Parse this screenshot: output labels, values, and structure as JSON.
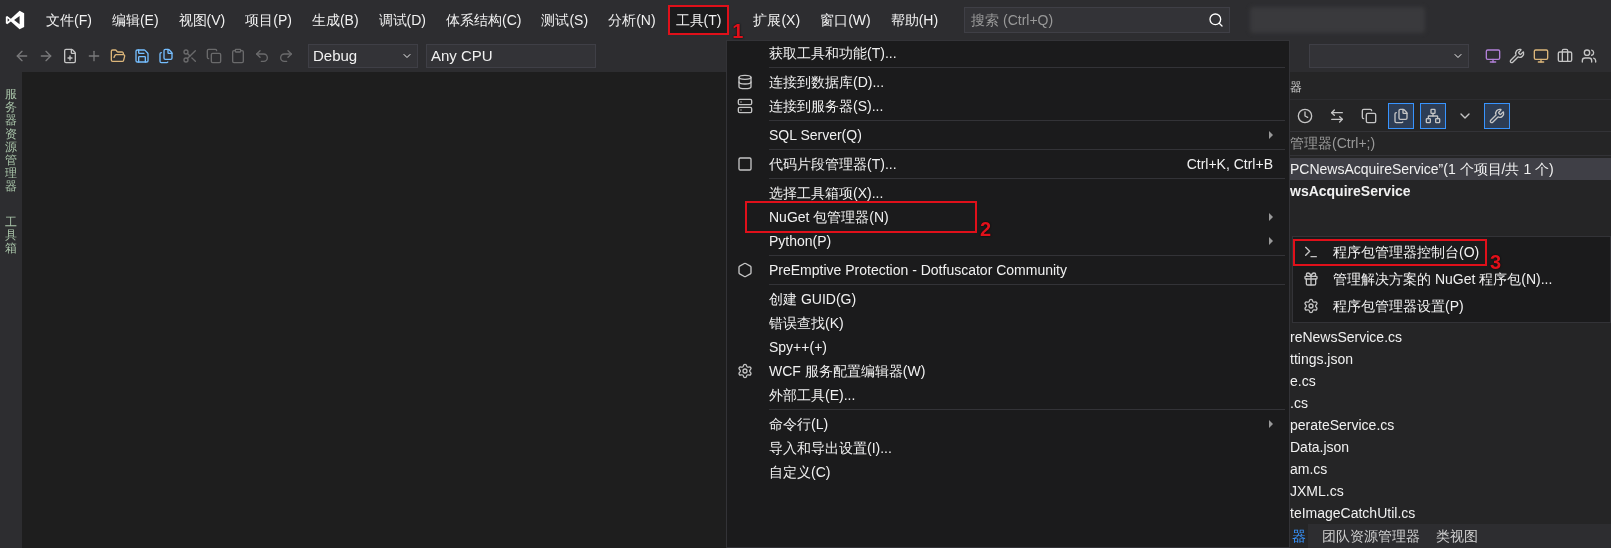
{
  "menu_bar": {
    "items": [
      {
        "label": "文件(F)",
        "selected": false
      },
      {
        "label": "编辑(E)",
        "selected": false
      },
      {
        "label": "视图(V)",
        "selected": false
      },
      {
        "label": "项目(P)",
        "selected": false
      },
      {
        "label": "生成(B)",
        "selected": false
      },
      {
        "label": "调试(D)",
        "selected": false
      },
      {
        "label": "体系结构(C)",
        "selected": false
      },
      {
        "label": "测试(S)",
        "selected": false
      },
      {
        "label": "分析(N)",
        "selected": false
      },
      {
        "label": "工具(T)",
        "selected": true,
        "callout": "1"
      },
      {
        "label": "扩展(X)",
        "selected": false
      },
      {
        "label": "窗口(W)",
        "selected": false
      },
      {
        "label": "帮助(H)",
        "selected": false
      }
    ],
    "search": {
      "placeholder": "搜索 (Ctrl+Q)"
    }
  },
  "toolbar": {
    "configuration": "Debug",
    "platform": "Any CPU"
  },
  "side_tabs": [
    "服务器资源管理器",
    "工具箱"
  ],
  "tools_menu": {
    "items": [
      {
        "kind": "item",
        "label": "获取工具和功能(T)..."
      },
      {
        "kind": "separator"
      },
      {
        "kind": "item",
        "label": "连接到数据库(D)..."
      },
      {
        "kind": "item",
        "label": "连接到服务器(S)..."
      },
      {
        "kind": "separator"
      },
      {
        "kind": "item",
        "label": "SQL Server(Q)",
        "submenu": true
      },
      {
        "kind": "separator"
      },
      {
        "kind": "item",
        "label": "代码片段管理器(T)...",
        "shortcut": "Ctrl+K, Ctrl+B"
      },
      {
        "kind": "separator"
      },
      {
        "kind": "item",
        "label": "选择工具箱项(X)..."
      },
      {
        "kind": "item",
        "label": "NuGet 包管理器(N)",
        "submenu": true,
        "callout": "2"
      },
      {
        "kind": "item",
        "label": "Python(P)",
        "submenu": true
      },
      {
        "kind": "separator"
      },
      {
        "kind": "item",
        "label": "PreEmptive Protection - Dotfuscator Community"
      },
      {
        "kind": "separator"
      },
      {
        "kind": "item",
        "label": "创建 GUID(G)"
      },
      {
        "kind": "item",
        "label": "错误查找(K)"
      },
      {
        "kind": "item",
        "label": "Spy++(+)"
      },
      {
        "kind": "item",
        "label": "WCF 服务配置编辑器(W)"
      },
      {
        "kind": "item",
        "label": "外部工具(E)..."
      },
      {
        "kind": "separator"
      },
      {
        "kind": "item",
        "label": "命令行(L)",
        "submenu": true
      },
      {
        "kind": "item",
        "label": "导入和导出设置(I)..."
      },
      {
        "kind": "item",
        "label": "自定义(C)"
      }
    ]
  },
  "nuget_submenu": {
    "items": [
      {
        "label": "程序包管理器控制台(O)",
        "callout": "3"
      },
      {
        "label": "管理解决方案的 NuGet 程序包(N)..."
      },
      {
        "label": "程序包管理器设置(P)"
      }
    ]
  },
  "solution_explorer": {
    "title": "器",
    "tool_buttons": [
      {
        "on": false
      },
      {
        "on": false
      },
      {
        "on": false
      },
      {
        "on": true
      },
      {
        "on": true
      },
      {
        "on": false
      },
      {
        "on": true
      }
    ],
    "search": {
      "placeholder": "管理器(Ctrl+;)"
    },
    "rows": [
      {
        "kind": "solution",
        "label": "PCNewsAcquireService”(1 个项目/共 1 个)",
        "selected": true
      },
      {
        "kind": "project",
        "label": "wsAcquireService",
        "selected": false
      },
      {
        "kind": "file",
        "label": "reNewsService.cs",
        "selected": false
      },
      {
        "kind": "file",
        "label": "ttings.json",
        "selected": false
      },
      {
        "kind": "file",
        "label": "e.cs",
        "selected": false
      },
      {
        "kind": "file",
        "label": ".cs",
        "selected": false
      },
      {
        "kind": "file",
        "label": "perateService.cs",
        "selected": false
      },
      {
        "kind": "file",
        "label": "Data.json",
        "selected": false
      },
      {
        "kind": "file",
        "label": "am.cs",
        "selected": false
      },
      {
        "kind": "file",
        "label": "JXML.cs",
        "selected": false
      },
      {
        "kind": "file",
        "label": "teImageCatchUtil.cs",
        "selected": false
      }
    ],
    "bottom_tabs": [
      {
        "label": "器",
        "selected": true
      },
      {
        "label": "团队资源管理器",
        "selected": false
      },
      {
        "label": "类视图",
        "selected": false
      }
    ]
  }
}
